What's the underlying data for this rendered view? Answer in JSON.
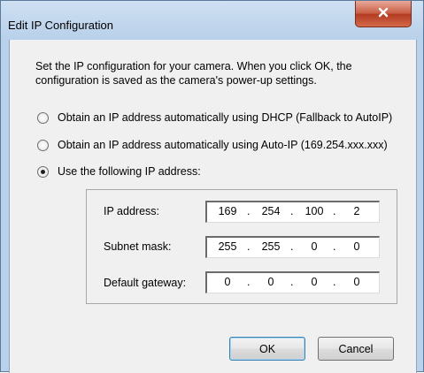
{
  "window": {
    "title": "Edit IP Configuration"
  },
  "intro_text": "Set the IP configuration for your camera.  When you click OK, the configuration is saved as the camera's power-up settings.",
  "options": [
    {
      "label": "Obtain an IP address automatically using DHCP (Fallback to AutoIP)",
      "selected": false
    },
    {
      "label": "Obtain an IP address automatically using Auto-IP (169.254.xxx.xxx)",
      "selected": false
    },
    {
      "label": "Use the following IP address:",
      "selected": true
    }
  ],
  "fields": {
    "ip_address": {
      "label": "IP address:",
      "octets": [
        "169",
        "254",
        "100",
        "2"
      ]
    },
    "subnet_mask": {
      "label": "Subnet mask:",
      "octets": [
        "255",
        "255",
        "0",
        "0"
      ]
    },
    "default_gateway": {
      "label": "Default gateway:",
      "octets": [
        "0",
        "0",
        "0",
        "0"
      ]
    }
  },
  "buttons": {
    "ok": "OK",
    "cancel": "Cancel"
  },
  "icons": {
    "close": "close-icon"
  }
}
